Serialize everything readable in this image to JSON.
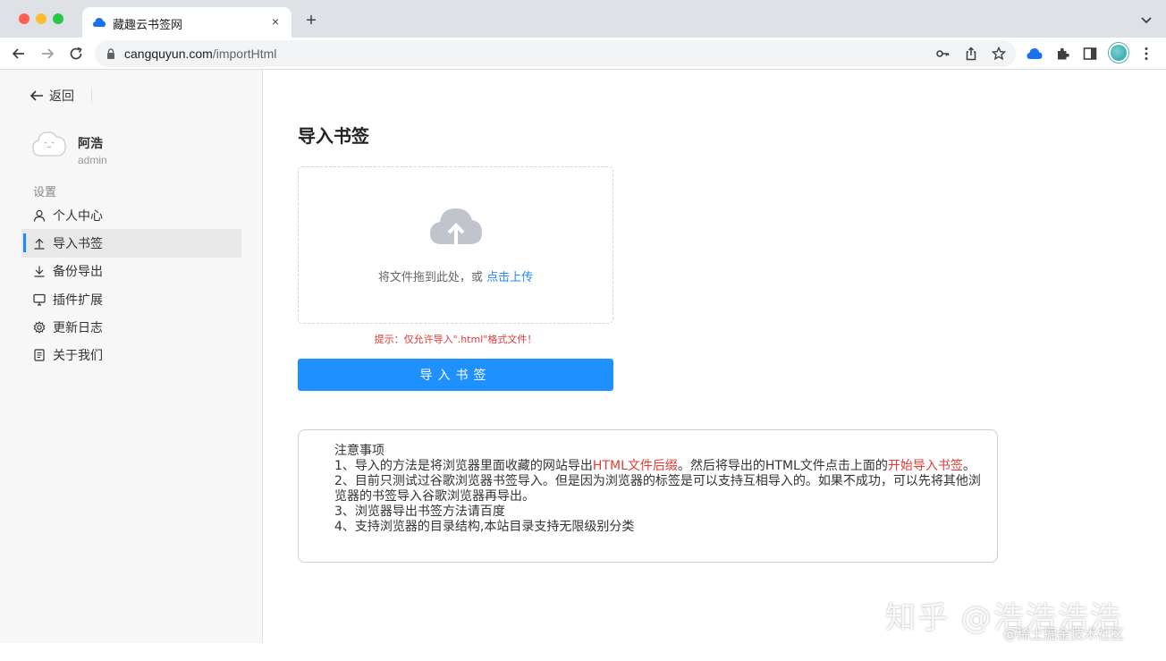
{
  "browser": {
    "tab_title": "藏趣云书签网",
    "url_host": "cangquyun.com",
    "url_path": "/importHtml",
    "new_tab_label": "+",
    "tab_close_label": "×"
  },
  "sidebar": {
    "back_label": "返回",
    "user_name": "阿浩",
    "user_role": "admin",
    "section_label": "设置",
    "items": [
      {
        "label": "个人中心",
        "icon": "user-icon",
        "active": false
      },
      {
        "label": "导入书签",
        "icon": "upload-icon",
        "active": true
      },
      {
        "label": "备份导出",
        "icon": "download-icon",
        "active": false
      },
      {
        "label": "插件扩展",
        "icon": "monitor-icon",
        "active": false
      },
      {
        "label": "更新日志",
        "icon": "gear-icon",
        "active": false
      },
      {
        "label": "关于我们",
        "icon": "document-icon",
        "active": false
      }
    ]
  },
  "main": {
    "title": "导入书签",
    "drop_text": "将文件拖到此处，或",
    "drop_link": "点击上传",
    "hint": "提示：仅允许导入\".html\"格式文件！",
    "import_button": "导入书签",
    "notes": {
      "heading": "注意事项",
      "line1_a": "1、导入的方法是将浏览器里面收藏的网站导出",
      "line1_red1": "HTML文件后缀",
      "line1_b": "。然后将导出的HTML文件点击上面的",
      "line1_red2": "开始导入书签",
      "line1_c": "。",
      "line2": "2、目前只测试过谷歌浏览器书签导入。但是因为浏览器的标签是可以支持互相导入的。如果不成功，可以先将其他浏览器的书签导入谷歌浏览器再导出。",
      "line3": "3、浏览器导出书签方法请百度",
      "line4": "4、支持浏览器的目录结构,本站目录支持无限级别分类"
    }
  },
  "watermark": {
    "zhihu": "知乎 @浩浩浩浩",
    "juejin": "@稀土掘金技术社区"
  },
  "colors": {
    "accent": "#1e90ff",
    "warning": "#e53935",
    "sidebar_bg": "#f7f7f7"
  }
}
